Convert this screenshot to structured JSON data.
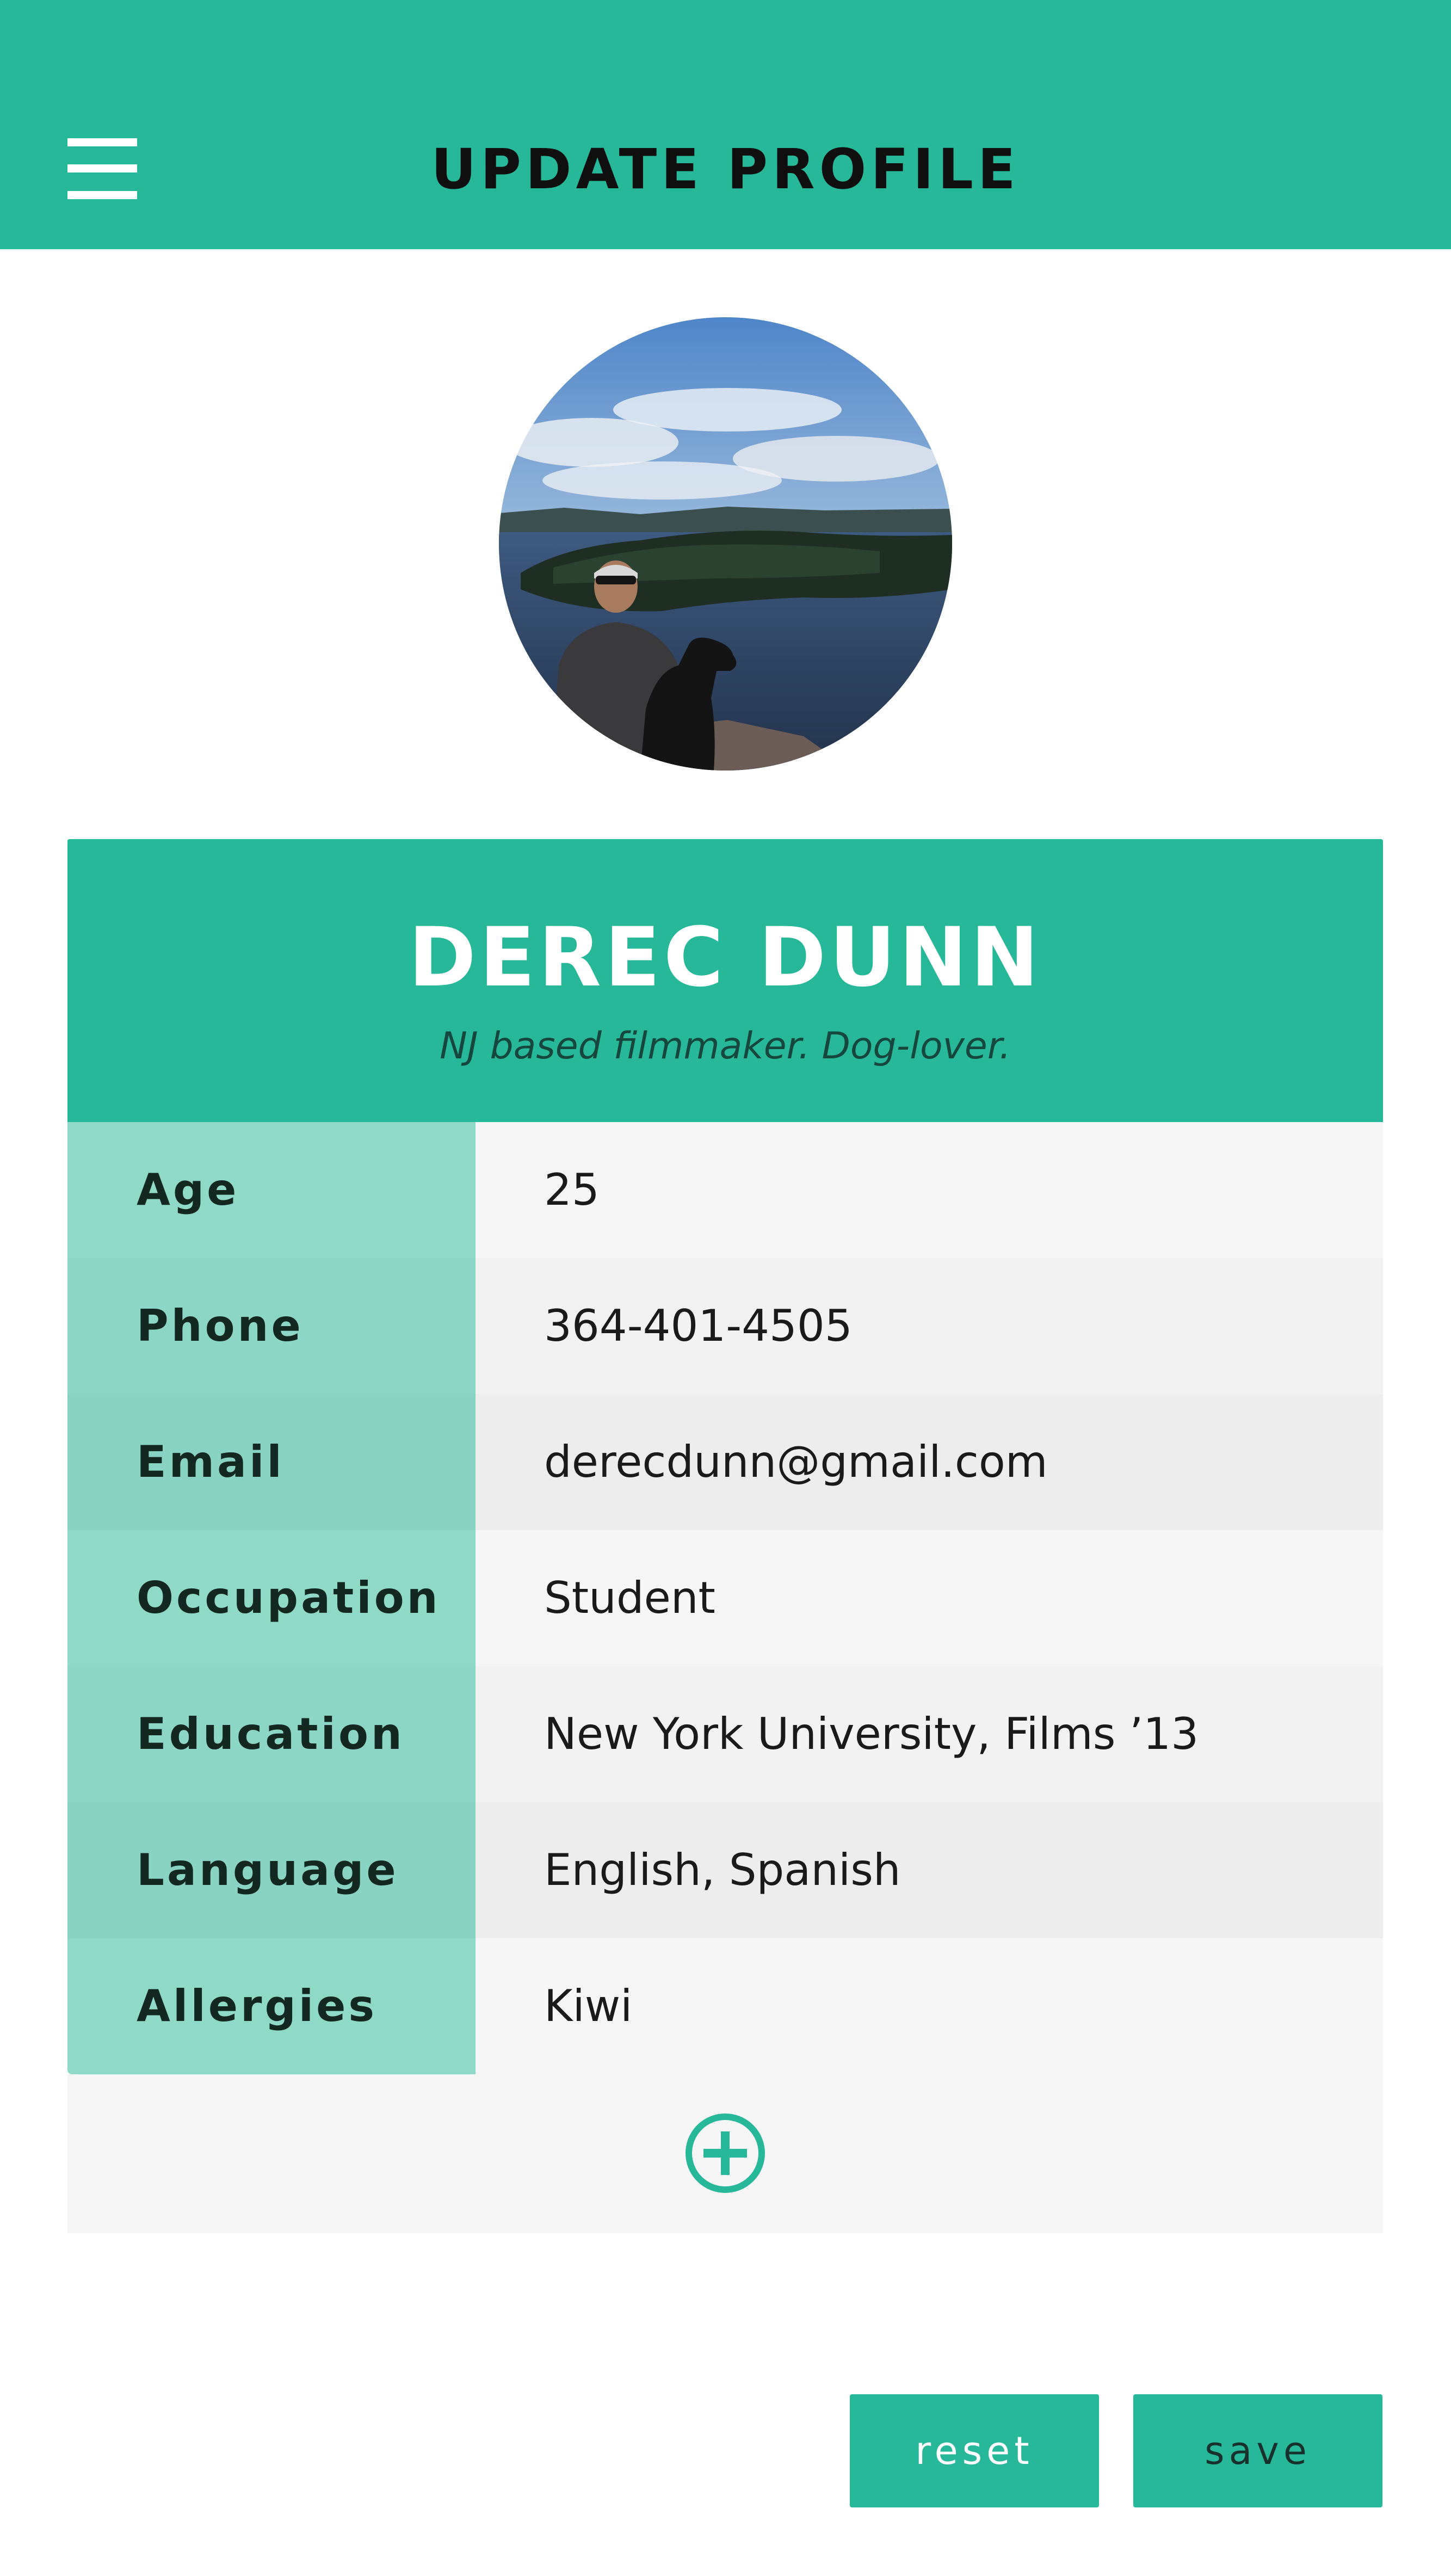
{
  "colors": {
    "accent": "#26b899",
    "label_bg": "#8cd6c5",
    "value_bg": "#f4f4f4"
  },
  "header": {
    "title": "UPDATE PROFILE",
    "menu_icon": "hamburger-menu-icon"
  },
  "profile": {
    "avatar_icon": "profile-photo",
    "name": "DEREC DUNN",
    "bio": "NJ based filmmaker. Dog-lover."
  },
  "details": [
    {
      "label": "Age",
      "value": "25"
    },
    {
      "label": "Phone",
      "value": "364-401-4505"
    },
    {
      "label": "Email",
      "value": "derecdunn@gmail.com"
    },
    {
      "label": "Occupation",
      "value": "Student"
    },
    {
      "label": "Education",
      "value": "New York University, Films ’13"
    },
    {
      "label": "Language",
      "value": "English, Spanish"
    },
    {
      "label": "Allergies",
      "value": "Kiwi"
    }
  ],
  "add_field_icon": "plus-circle-icon",
  "actions": {
    "reset_label": "reset",
    "save_label": "save"
  }
}
